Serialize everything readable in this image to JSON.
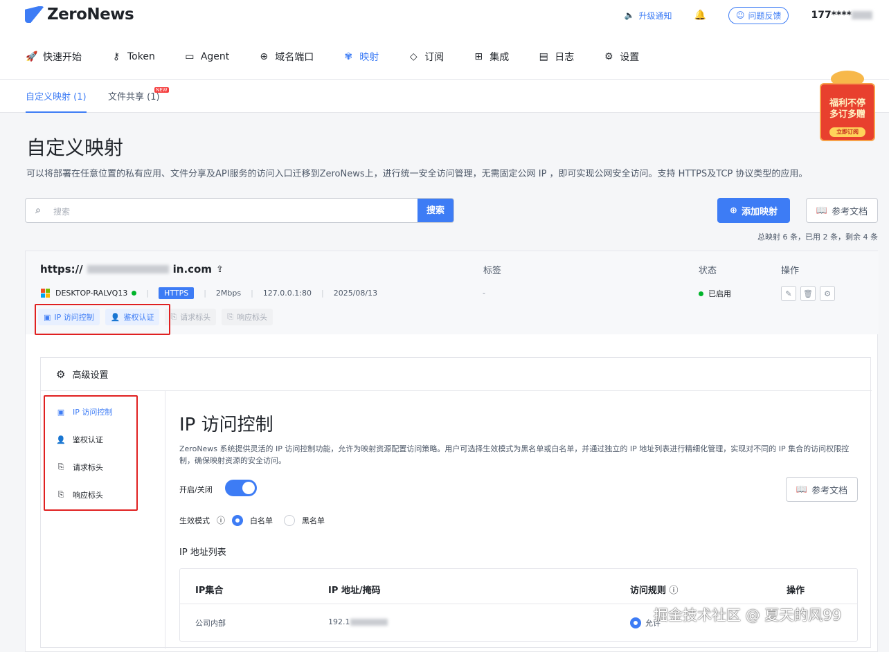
{
  "brand": {
    "name": "ZeroNews"
  },
  "topbar": {
    "upgrade": "升级通知",
    "feedback": "问题反馈",
    "user": "177****"
  },
  "nav": [
    {
      "label": "快速开始",
      "icon": "rocket-icon"
    },
    {
      "label": "Token",
      "icon": "key-icon"
    },
    {
      "label": "Agent",
      "icon": "laptop-icon"
    },
    {
      "label": "域名端口",
      "icon": "globe-icon"
    },
    {
      "label": "映射",
      "icon": "mapping-icon"
    },
    {
      "label": "订阅",
      "icon": "diamond-icon"
    },
    {
      "label": "集成",
      "icon": "grid-icon"
    },
    {
      "label": "日志",
      "icon": "file-icon"
    },
    {
      "label": "设置",
      "icon": "gear-icon"
    }
  ],
  "subtabs": {
    "custom": "自定义映射 (1)",
    "share": "文件共享 (1)",
    "new_badge": "NEW"
  },
  "promo": {
    "line1": "福利不停",
    "line2": "多订多赠",
    "button": "立即订阅"
  },
  "page": {
    "title": "自定义映射",
    "desc": "可以将部署在任意位置的私有应用、文件分享及API服务的访问入口迁移到ZeroNews上，进行统一安全访问管理，无需固定公网 IP ，即可实现公网安全访问。支持 HTTPS及TCP 协议类型的应用。"
  },
  "search": {
    "placeholder": "搜索",
    "button": "搜索"
  },
  "actions": {
    "add": "添加映射",
    "doc": "参考文档"
  },
  "summary": "总映射 6 条，已用 2 条，剩余 4 条",
  "mapping": {
    "url_prefix": "https://",
    "url_suffix": "in.com",
    "col_tag": "标签",
    "col_status": "状态",
    "col_ops": "操作",
    "device": "DESKTOP-RALVQ13",
    "protocol": "HTTPS",
    "bandwidth": "2Mbps",
    "address": "127.0.0.1:80",
    "date": "2025/08/13",
    "tag": "-",
    "status": "已启用",
    "chips": [
      "IP 访问控制",
      "鉴权认证",
      "请求标头",
      "响应标头"
    ]
  },
  "advanced": {
    "title": "高级设置",
    "side": [
      "IP 访问控制",
      "鉴权认证",
      "请求标头",
      "响应标头"
    ],
    "ipc_title": "IP 访问控制",
    "ipc_desc": "ZeroNews 系统提供灵活的 IP 访问控制功能，允许为映射资源配置访问策略。用户可选择生效模式为黑名单或白名单，并通过独立的 IP 地址列表进行精细化管理，实现对不同的 IP 集合的访问权限控制，确保映射资源的安全访问。",
    "toggle_label": "开启/关闭",
    "toggle_on": true,
    "doc": "参考文档",
    "mode_label": "生效模式",
    "mode_white": "白名单",
    "mode_black": "黑名单",
    "mode_selected": "白名单",
    "iplist_title": "IP 地址列表",
    "table_headers": [
      "IP集合",
      "IP 地址/掩码",
      "访问规则",
      "操作"
    ],
    "rows": [
      {
        "set": "公司内部",
        "ip": "192.1",
        "rule": "允许"
      }
    ]
  },
  "watermark": "掘金技术社区 @ 夏天的风99",
  "colors": {
    "accent": "#3d7cf5",
    "highlight_box": "#e02020",
    "status_ok": "#00b42a"
  }
}
